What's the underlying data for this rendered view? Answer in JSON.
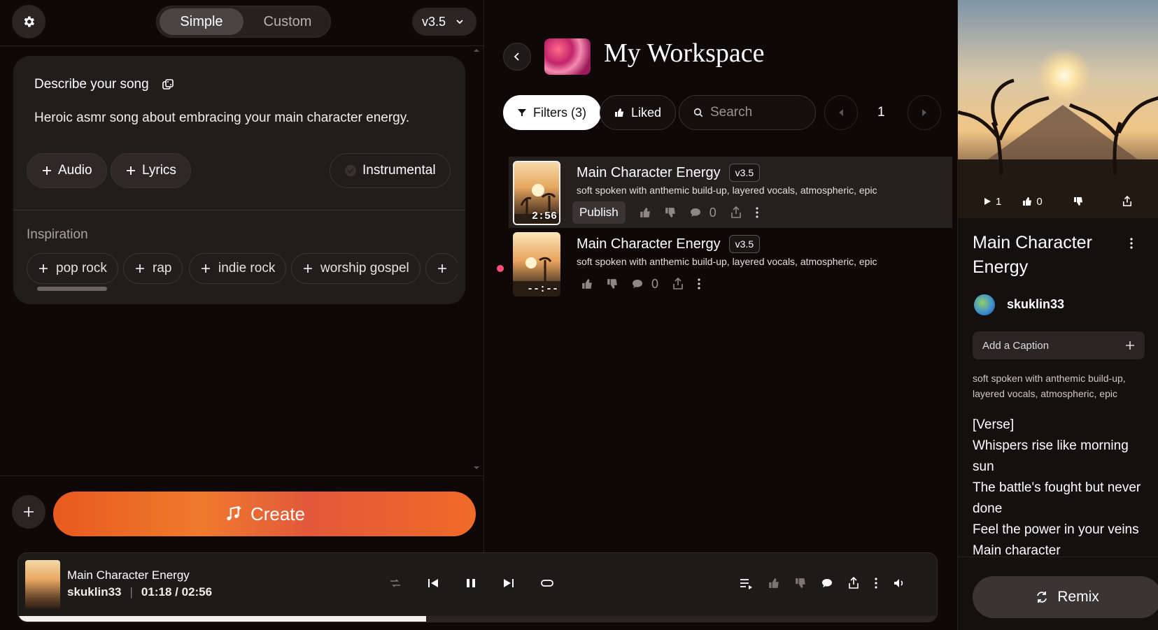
{
  "left": {
    "mode_simple": "Simple",
    "mode_custom": "Custom",
    "version": "v3.5",
    "describe_label": "Describe your song",
    "prompt": "Heroic asmr song about embracing your main character energy.",
    "audio_label": "Audio",
    "lyrics_label": "Lyrics",
    "instrumental_label": "Instrumental",
    "inspiration_label": "Inspiration",
    "chips": [
      "pop rock",
      "rap",
      "indie rock",
      "worship gospel"
    ],
    "create_label": "Create"
  },
  "workspace": {
    "title": "My Workspace",
    "filters_label": "Filters (3)",
    "liked_label": "Liked",
    "search_placeholder": "Search",
    "page": "1",
    "songs": [
      {
        "title": "Main Character Energy",
        "version": "v3.5",
        "desc": "soft spoken with anthemic build-up, layered vocals, atmospheric, epic",
        "duration": "2:56",
        "publish_label": "Publish",
        "comments": "0"
      },
      {
        "title": "Main Character Energy",
        "version": "v3.5",
        "desc": "soft spoken with anthemic build-up, layered vocals, atmospheric, epic",
        "duration": "--:--",
        "comments": "0"
      }
    ]
  },
  "detail": {
    "plays": "1",
    "likes": "0",
    "title": "Main Character Energy",
    "username": "skuklin33",
    "caption_label": "Add a Caption",
    "desc": "soft spoken with anthemic build-up, layered vocals, atmospheric, epic",
    "lyrics": [
      "[Verse]",
      "Whispers rise like morning sun",
      "The battle's fought but never done",
      "Feel the power in your veins",
      "Main character"
    ],
    "remix_label": "Remix"
  },
  "player": {
    "title": "Main Character Energy",
    "artist": "skuklin33",
    "time": "01:18 / 02:56",
    "progress": 0.443
  },
  "colors": {
    "accent_orange": "#ef6a28",
    "pink_dot": "#ff4f7a"
  }
}
